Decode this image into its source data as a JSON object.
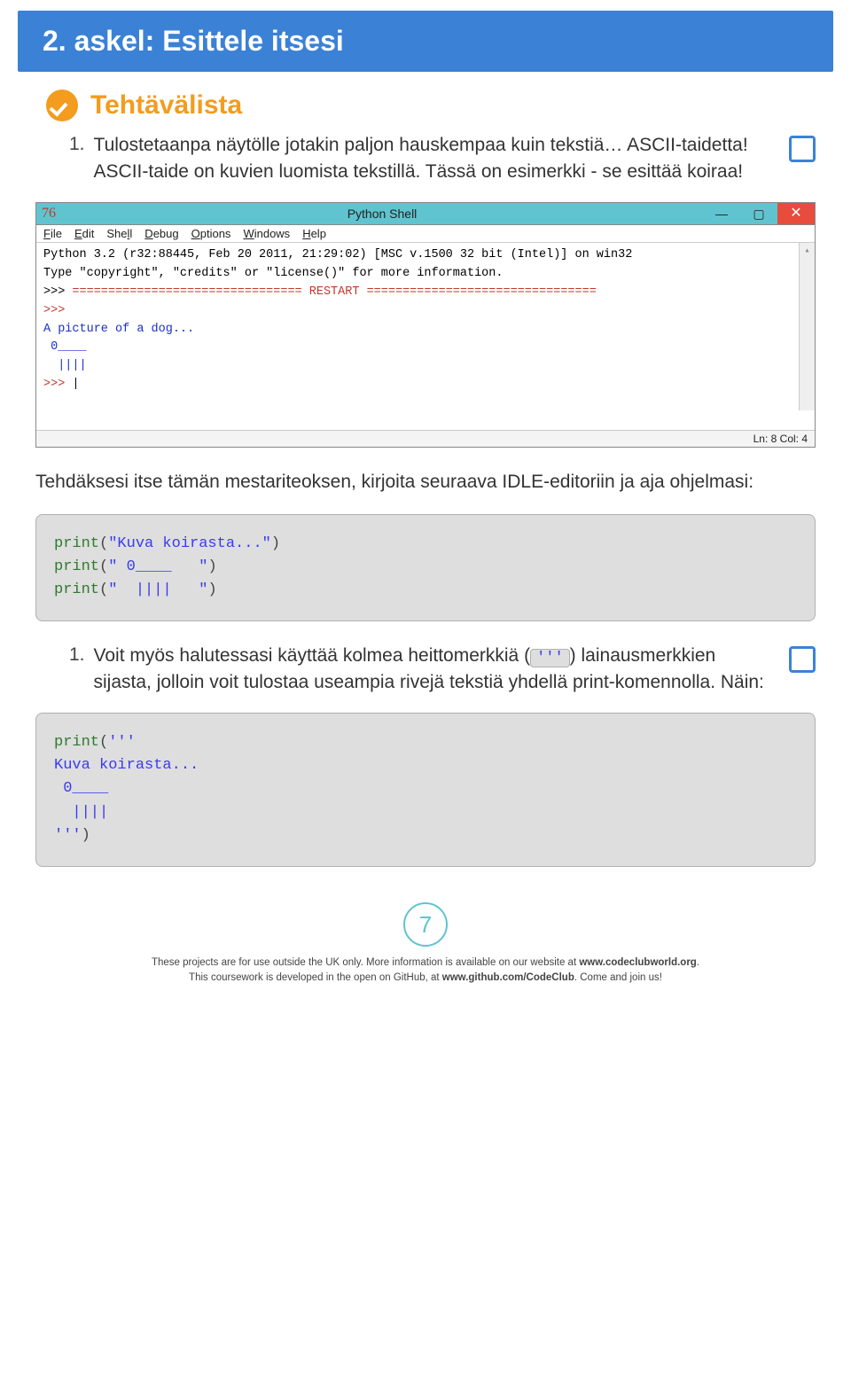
{
  "header": {
    "step_title": "2. askel: Esittele itsesi"
  },
  "checklist": {
    "title": "Tehtävälista"
  },
  "task1": {
    "num": "1.",
    "text": "Tulostetaanpa näytölle jotakin paljon hauskempaa kuin tekstiä… ASCII-taidetta! ASCII-taide on kuvien luomista tekstillä. Tässä on esimerkki - se esittää koiraa!"
  },
  "window": {
    "icon": "76",
    "title": "Python Shell",
    "menu": [
      "File",
      "Edit",
      "Shell",
      "Debug",
      "Options",
      "Windows",
      "Help"
    ],
    "lines": {
      "l1": "Python 3.2 (r32:88445, Feb 20 2011, 21:29:02) [MSC v.1500 32 bit (Intel)] on win32",
      "l2": "Type \"copyright\", \"credits\" or \"license()\" for more information.",
      "restart_prefix": ">>> ",
      "restart_eq1": "================================",
      "restart_word": " RESTART ",
      "restart_eq2": "================================",
      "bare_prompt": ">>>",
      "blue1": "A picture of a dog...",
      "blue2": " 0____",
      "blue3": "  ||||",
      "final_prompt": ">>> ",
      "cursor": "|"
    },
    "status": "Ln: 8 Col: 4"
  },
  "para1": "Tehdäksesi itse tämän mestariteoksen, kirjoita seuraava IDLE-editoriin ja aja ohjelmasi:",
  "code1": {
    "p1": "print",
    "s1": "\"Kuva koirasta...\"",
    "p2": "print",
    "s2": "\" 0____   \"",
    "p3": "print",
    "s3": "\"  ||||   \""
  },
  "task2": {
    "num": "1.",
    "t_a": "Voit myös halutessasi käyttää kolmea heittomerkkiä (",
    "code": "'''",
    "t_b": ") lainausmerkkien sijasta, jolloin voit tulostaa useampia rivejä tekstiä yhdellä print-komennolla. Näin:"
  },
  "code2": {
    "p1": "print",
    "open": "'''",
    "l1": "Kuva koirasta...",
    "l2": " 0____",
    "l3": "  ||||",
    "close": "'''"
  },
  "footer": {
    "page": "7",
    "line1a": "These projects are for use outside the UK only. More information is available on our website at ",
    "line1b": "www.codeclubworld.org",
    "line1c": ".",
    "line2a": "This coursework is developed in the open on GitHub, at ",
    "line2b": "www.github.com/CodeClub",
    "line2c": ". Come and join us!"
  }
}
